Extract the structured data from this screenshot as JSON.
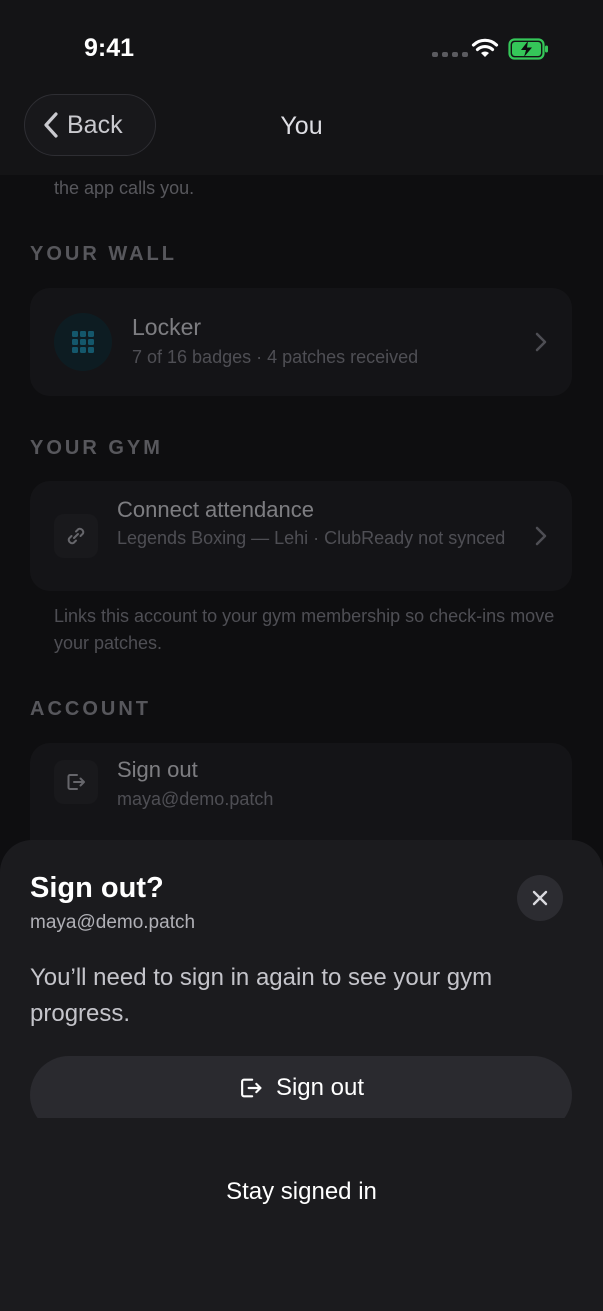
{
  "status_bar": {
    "time": "9:41",
    "wifi_icon": "wifi-icon",
    "battery_icon": "battery-charging-icon",
    "battery_color": "#35c759"
  },
  "nav": {
    "back_label": "Back",
    "title": "You"
  },
  "intro": {
    "tail_text": "the app calls you."
  },
  "wall": {
    "heading": "YOUR WALL",
    "locker": {
      "title": "Locker",
      "subtitle": "7 of 16 badges · 4 patches received",
      "icon": "grid-icon",
      "icon_color": "#1a9bbf"
    }
  },
  "gym": {
    "heading": "YOUR GYM",
    "connect": {
      "title": "Connect attendance",
      "subtitle": "Legends Boxing — Lehi · ClubReady not synced",
      "icon": "link-icon"
    },
    "helper": "Links this account to your gym membership so check-ins move your patches."
  },
  "account": {
    "heading": "ACCOUNT",
    "signout": {
      "title": "Sign out",
      "subtitle": "maya@demo.patch",
      "icon": "sign-out-icon"
    }
  },
  "sheet": {
    "title": "Sign out?",
    "email": "maya@demo.patch",
    "body": "You’ll need to sign in again to see your gym progress.",
    "confirm_label": "Sign out",
    "cancel_label": "Stay signed in",
    "close_icon": "close-icon"
  }
}
